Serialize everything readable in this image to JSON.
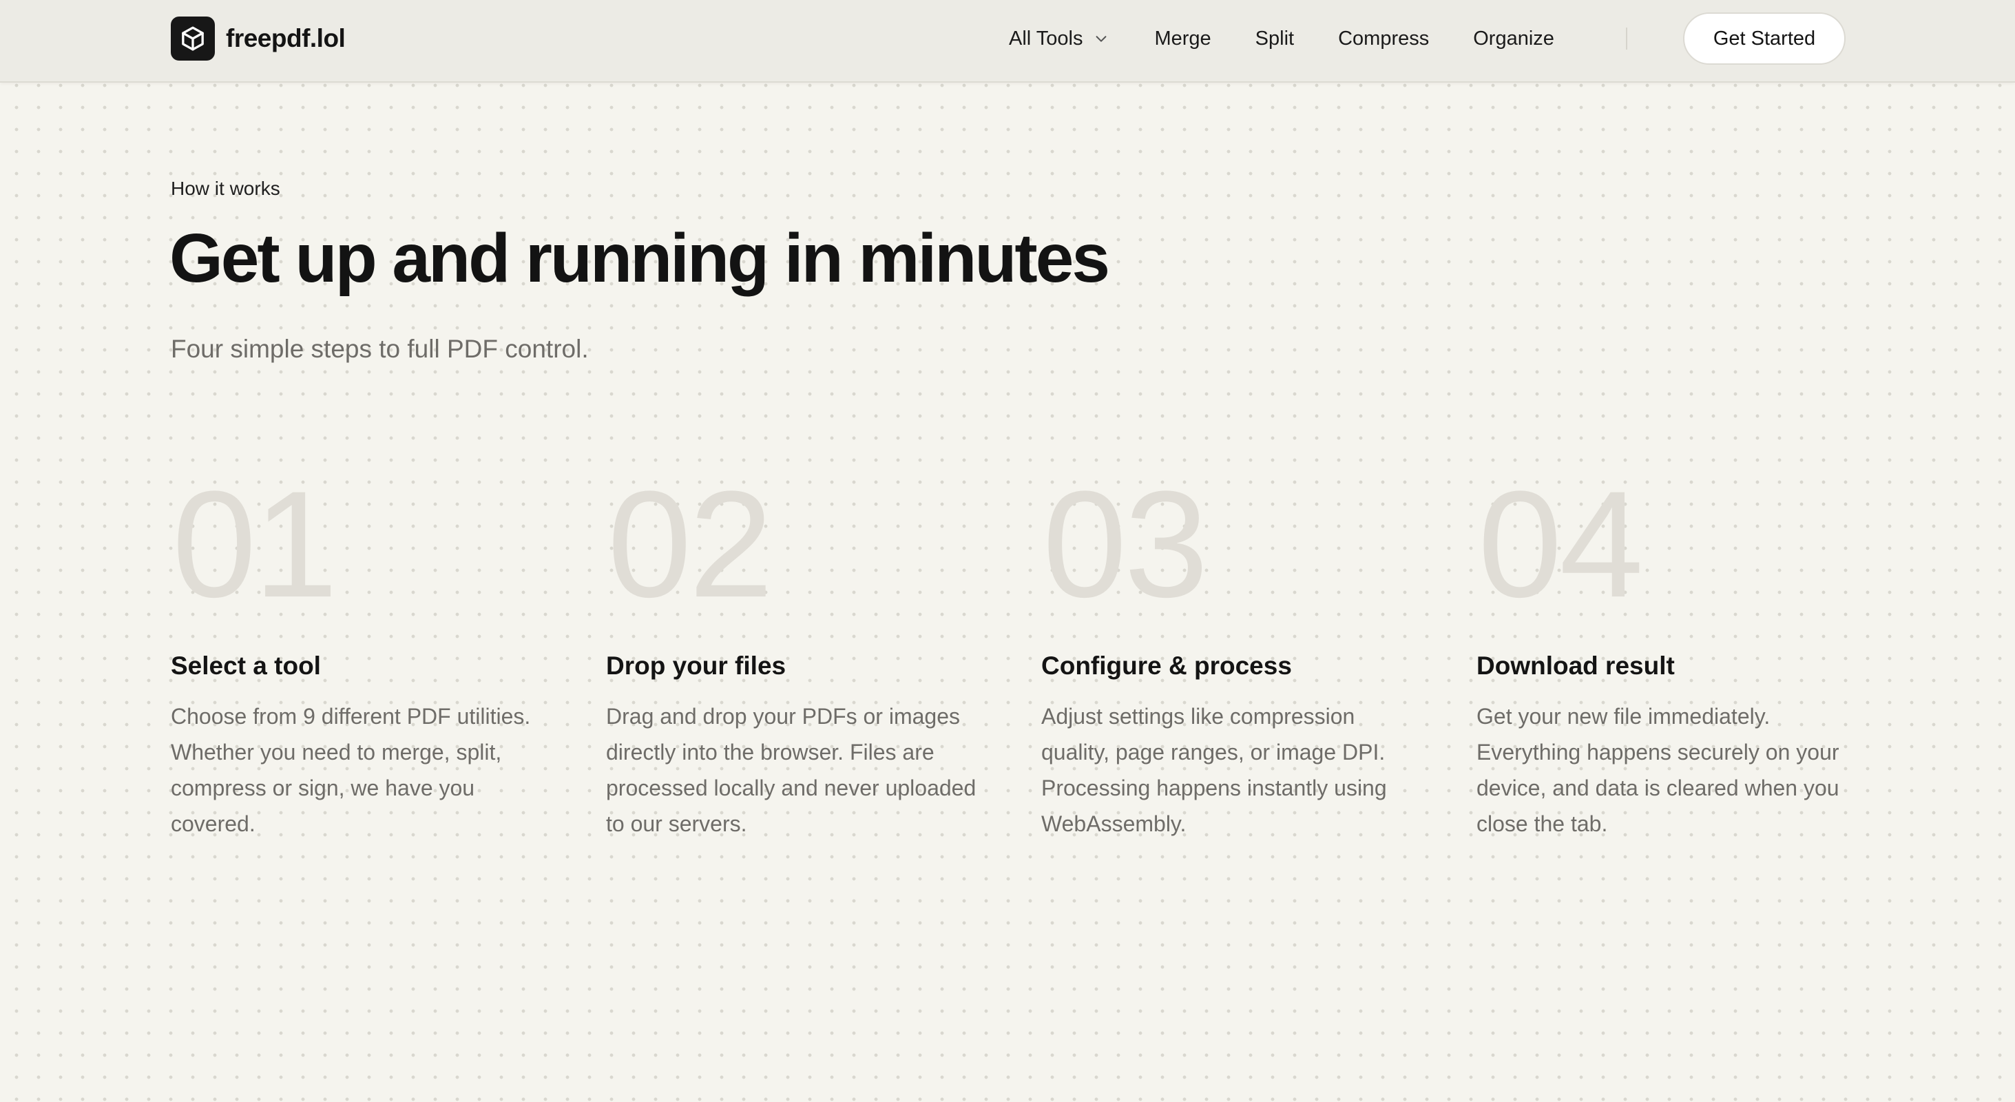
{
  "header": {
    "brand": "freepdf.lol",
    "logo_icon": "cube-icon",
    "nav": {
      "all_tools": "All Tools",
      "merge": "Merge",
      "split": "Split",
      "compress": "Compress",
      "organize": "Organize"
    },
    "cta": "Get Started"
  },
  "hero": {
    "eyebrow": "How it works",
    "title": "Get up and running in minutes",
    "subtitle": "Four simple steps to full PDF control."
  },
  "steps": [
    {
      "number": "01",
      "title": "Select a tool",
      "description": "Choose from 9 different PDF utilities. Whether you need to merge, split, compress or sign, we have you covered."
    },
    {
      "number": "02",
      "title": "Drop your files",
      "description": "Drag and drop your PDFs or images directly into the browser. Files are processed locally and never uploaded to our servers."
    },
    {
      "number": "03",
      "title": "Configure & process",
      "description": "Adjust settings like compression quality, page ranges, or image DPI. Processing happens instantly using WebAssembly."
    },
    {
      "number": "04",
      "title": "Download result",
      "description": "Get your new file immediately. Everything happens securely on your device, and data is cleared when you close the tab."
    }
  ],
  "colors": {
    "background": "#f5f4ee",
    "header_background": "#ecebe5",
    "text": "#141414",
    "muted_text": "#6e6c68",
    "step_number": "#e0ddd6",
    "logo_background": "#171717"
  }
}
